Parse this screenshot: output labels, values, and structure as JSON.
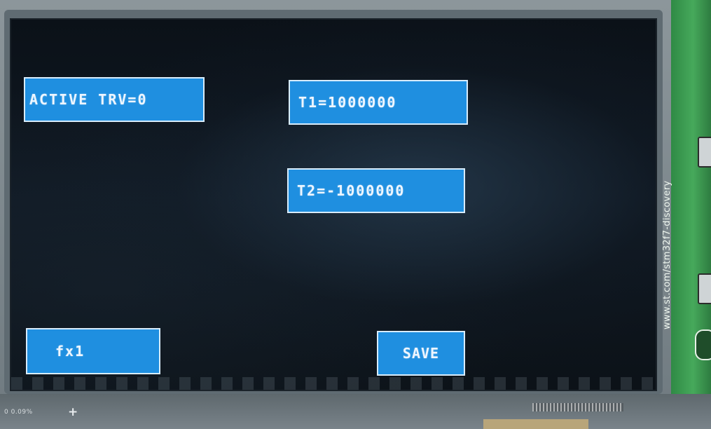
{
  "display": {
    "active_trv_label": "ACTIVE TRV=0",
    "t1_label": "T1=1000000",
    "t2_label": "T2=-1000000",
    "fx_label": "fx1",
    "save_label": "SAVE",
    "colors": {
      "button_fill": "#1f8fe0",
      "button_border": "#d8ecfb",
      "screen_bg": "#0b1118"
    }
  },
  "board": {
    "silkscreen_text": "www.st.com/stm32f7-discovery",
    "bottom_tag_text": "0 0.09%",
    "plus_icon": "plus-icon"
  }
}
